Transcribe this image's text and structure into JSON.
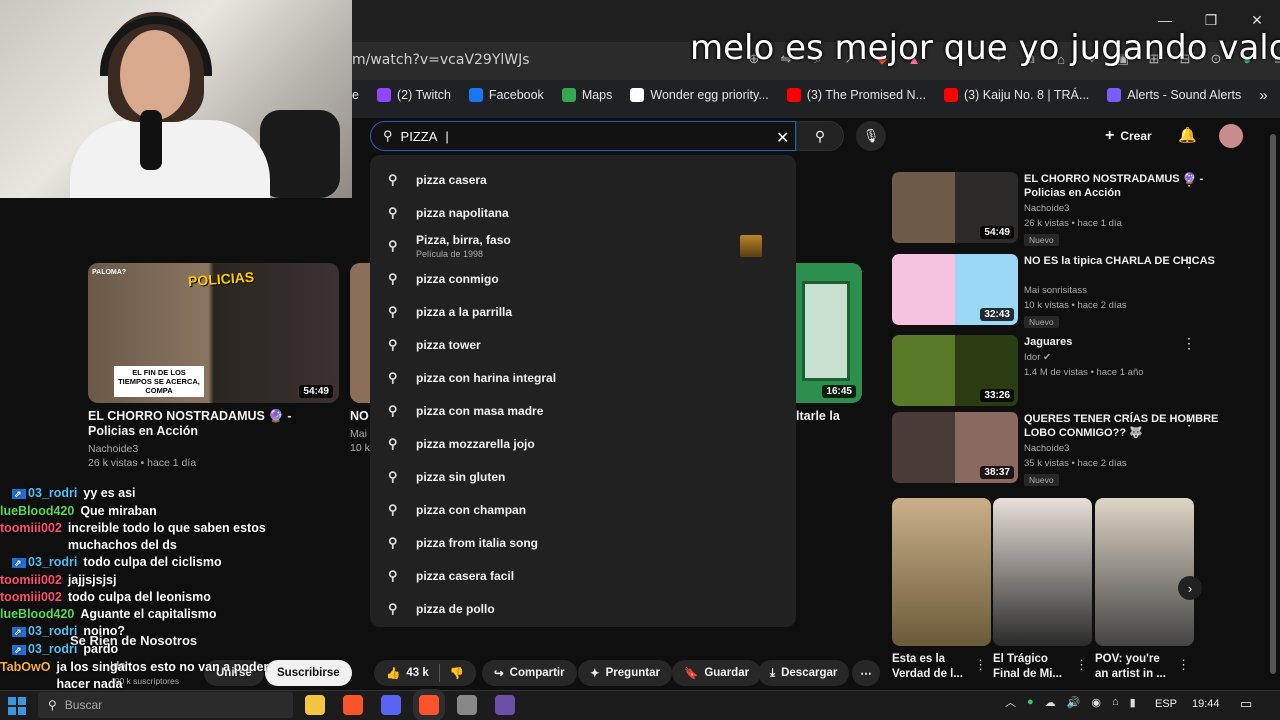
{
  "overlay_caption": "melo es mejor que yo jugando valo",
  "browser": {
    "url": "m/watch?v=vcaV29YlWJs",
    "bookmarks": [
      {
        "label": "e",
        "color": "#0f0f0f"
      },
      {
        "label": "(2) Twitch",
        "color": "#9146ff"
      },
      {
        "label": "Facebook",
        "color": "#1877f2"
      },
      {
        "label": "Maps",
        "color": "#34a853"
      },
      {
        "label": "Wonder egg priority...",
        "color": "#ffffff"
      },
      {
        "label": "(3) The Promised N...",
        "color": "#ff0000"
      },
      {
        "label": "(3) Kaiju No. 8 | TRÁ...",
        "color": "#ff0000"
      },
      {
        "label": "Alerts - Sound Alerts",
        "color": "#7a5cff"
      }
    ],
    "more": "»"
  },
  "window_controls": {
    "minimize": "—",
    "restore": "❐",
    "close": "✕"
  },
  "youtube": {
    "search_value": "PIZZA",
    "create_label": "Crear",
    "suggestions": [
      {
        "text": "pizza casera"
      },
      {
        "text": "pizza napolitana"
      },
      {
        "text": "Pizza, birra, faso",
        "sub": "Película de 1998"
      },
      {
        "text": "pizza conmigo"
      },
      {
        "text": "pizza a la parrilla"
      },
      {
        "text": "pizza tower"
      },
      {
        "text": "pizza con harina integral"
      },
      {
        "text": "pizza con masa madre"
      },
      {
        "text": "pizza mozzarella jojo"
      },
      {
        "text": "pizza sin gluten"
      },
      {
        "text": "pizza con champan"
      },
      {
        "text": "pizza from italia song"
      },
      {
        "text": "pizza casera facil"
      },
      {
        "text": "pizza de pollo"
      }
    ],
    "feed_card": {
      "title": "EL CHORRO NOSTRADAMUS 🔮 - Policias en Acción",
      "channel": "Nachoide3",
      "meta": "26 k vistas • hace 1 día",
      "duration": "54:49",
      "thumb_text": "EL FIN DE LOS TIEMPOS SE ACERCA, COMPA",
      "thumb_label": "PALOMA?",
      "thumb_tag": "POLICIAS"
    },
    "partial_card": {
      "title": "NO",
      "channel": "Mai",
      "meta": "10 k"
    },
    "right_card": {
      "title": "ltarle la",
      "duration": "16:45"
    },
    "sidebar": [
      {
        "title": "EL CHORRO NOSTRADAMUS 🔮 - Policias en Acción",
        "channel": "Nachoide3",
        "meta": "26 k vistas • hace 1 día",
        "duration": "54:49",
        "badge": "Nuevo",
        "colors": [
          "#6d5a48",
          "#2d2a2a"
        ]
      },
      {
        "title": "NO ES la tipica CHARLA DE CHICAS",
        "channel": "Mai sonrisitass",
        "meta": "10 k vistas • hace 2 días",
        "duration": "32:43",
        "badge": "Nuevo",
        "colors": [
          "#f5c3e0",
          "#9ad8f5"
        ]
      },
      {
        "title": "Jaguares",
        "channel": "Idor ✔",
        "meta": "1.4 M de vistas • hace 1 año",
        "duration": "33:26",
        "badge": "",
        "colors": [
          "#5a7a2a",
          "#2b3b12"
        ]
      },
      {
        "title": "QUERES TENER CRÍAS DE HOMBRE LOBO CONMIGO?? 🐺",
        "channel": "Nachoide3",
        "meta": "35 k vistas • hace 2 días",
        "duration": "38:37",
        "badge": "Nuevo",
        "colors": [
          "#4a3a38",
          "#8a6a60"
        ]
      }
    ],
    "shorts": [
      {
        "title": "Esta es la Verdad de l...",
        "colors": [
          "#c9b08a",
          "#6b5a3a"
        ]
      },
      {
        "title": "El Trágico Final de Mi...",
        "colors": [
          "#e8e0d8",
          "#2a2a2a"
        ]
      },
      {
        "title": "POV: you're an artist in ...",
        "colors": [
          "#ddd4c4",
          "#444"
        ]
      }
    ],
    "video_channel": "Se Rien de Nosotros",
    "channel_handle": "Idor",
    "subscribers": "490 k suscriptores",
    "actions": {
      "join": "Unirse",
      "subscribe": "Suscribirse",
      "likes": "43 k",
      "share": "Compartir",
      "ask": "Preguntar",
      "save": "Guardar",
      "download": "Descargar"
    }
  },
  "chat": [
    {
      "name": "03_rodri",
      "color": "#4fc3f7",
      "badge": true,
      "msg": "yy es asi"
    },
    {
      "name": "lueBlood420",
      "color": "#57d957",
      "badge": false,
      "msg": "Que miraban"
    },
    {
      "name": "toomiii002",
      "color": "#ff4d6d",
      "badge": false,
      "msg": "increible todo lo que saben estos muchachos del ds"
    },
    {
      "name": "03_rodri",
      "color": "#4fc3f7",
      "badge": true,
      "msg": "todo culpa del ciclismo"
    },
    {
      "name": "toomiii002",
      "color": "#ff4d6d",
      "badge": false,
      "msg": "jajjsjsjsj"
    },
    {
      "name": "toomiii002",
      "color": "#ff4d6d",
      "badge": false,
      "msg": "todo culpa del leonismo"
    },
    {
      "name": "lueBlood420",
      "color": "#57d957",
      "badge": false,
      "msg": "Aguante el capitalismo"
    },
    {
      "name": "03_rodri",
      "color": "#4fc3f7",
      "badge": true,
      "msg": "noino?"
    },
    {
      "name": "03_rodri",
      "color": "#4fc3f7",
      "badge": true,
      "msg": "pardo"
    },
    {
      "name": "TabOwO",
      "color": "#f5b041",
      "badge": false,
      "msg": "ja los singaitos esto no van a poder hacer nada"
    }
  ],
  "taskbar": {
    "search_placeholder": "Buscar",
    "lang": "ESP",
    "time": "19:44",
    "apps": [
      {
        "name": "file-explorer",
        "color": "#f5c542"
      },
      {
        "name": "brave",
        "color": "#fb542b"
      },
      {
        "name": "discord",
        "color": "#5865f2"
      },
      {
        "name": "brave-active",
        "color": "#fb542b"
      },
      {
        "name": "chrome-like",
        "color": "#888888"
      },
      {
        "name": "obs",
        "color": "#6f4ea8"
      }
    ]
  }
}
